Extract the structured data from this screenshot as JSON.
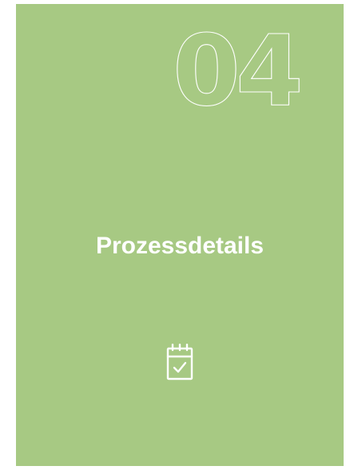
{
  "card": {
    "background_color": "#a7c983",
    "step_number": "04",
    "title": "Prozessdetails",
    "icon": "calendar-check-icon"
  }
}
